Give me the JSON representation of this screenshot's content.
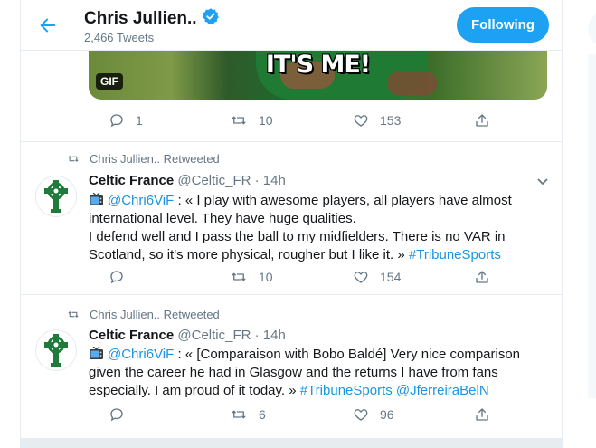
{
  "header": {
    "title": "Chris Jullien..",
    "subtitle": "2,466 Tweets",
    "follow_label": "Following"
  },
  "gif": {
    "caption": "IT'S ME!",
    "badge": "GIF"
  },
  "top_actions": {
    "replies": "1",
    "retweets": "10",
    "likes": "153"
  },
  "tweets": [
    {
      "retweeted_by": "Chris Jullien.. Retweeted",
      "name": "Celtic France",
      "handle": "@Celtic_FR",
      "time": "· 14h",
      "mention": "@Chri6ViF",
      "text": " : « I play with awesome players, all players have almost international level. They have huge qualities.",
      "text2": "I defend well and I pass the ball to my midfielders. There is no VAR in Scotland, so it's more physical, rougher but I like it. » ",
      "hashtag": "#TribuneSports",
      "extra_mention": "",
      "replies": "",
      "retweets": "10",
      "likes": "154"
    },
    {
      "retweeted_by": "Chris Jullien.. Retweeted",
      "name": "Celtic France",
      "handle": "@Celtic_FR",
      "time": "· 14h",
      "mention": "@Chri6ViF",
      "text": " : « [Comparaison with Bobo Baldé] Very nice comparison given the career he had in Glasgow and the returns I have from fans especially. I am proud of it today. » ",
      "text2": "",
      "hashtag": "#TribuneSports",
      "extra_mention": "@JferreiraBelN",
      "replies": "",
      "retweets": "6",
      "likes": "96"
    }
  ],
  "colors": {
    "accent": "#1da1f2",
    "link": "#1b95e0",
    "muted": "#657786",
    "celtic_green": "#1e7b3a"
  },
  "icons": [
    "back-arrow-icon",
    "verified-badge-icon",
    "reply-icon",
    "retweet-icon",
    "like-icon",
    "share-icon",
    "retweet-small-icon",
    "chevron-down-icon",
    "tv-emoji-icon",
    "celtic-cross-logo"
  ]
}
